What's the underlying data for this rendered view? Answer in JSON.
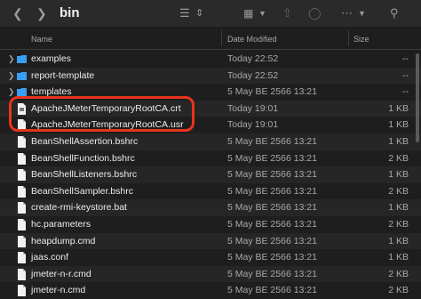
{
  "window": {
    "title": "bin"
  },
  "toolbar": {
    "back_icon": "chevron-left-icon",
    "forward_icon": "chevron-right-icon",
    "view_icon": "list-view-icon",
    "group_icon": "grid-icon",
    "share_icon": "share-icon",
    "tag_icon": "tag-icon",
    "more_icon": "ellipsis-circle-icon"
  },
  "columns": {
    "name": "Name",
    "date": "Date Modified",
    "size": "Size"
  },
  "rows": [
    {
      "name": "examples",
      "date": "Today 22:52",
      "size": "--",
      "kind": "folder"
    },
    {
      "name": "report-template",
      "date": "Today 22:52",
      "size": "--",
      "kind": "folder"
    },
    {
      "name": "templates",
      "date": "5 May BE 2566 13:21",
      "size": "--",
      "kind": "folder"
    },
    {
      "name": "ApacheJMeterTemporaryRootCA.crt",
      "date": "Today 19:01",
      "size": "1 KB",
      "kind": "cert"
    },
    {
      "name": "ApacheJMeterTemporaryRootCA.usr",
      "date": "Today 19:01",
      "size": "1 KB",
      "kind": "file"
    },
    {
      "name": "BeanShellAssertion.bshrc",
      "date": "5 May BE 2566 13:21",
      "size": "1 KB",
      "kind": "file"
    },
    {
      "name": "BeanShellFunction.bshrc",
      "date": "5 May BE 2566 13:21",
      "size": "2 KB",
      "kind": "file"
    },
    {
      "name": "BeanShellListeners.bshrc",
      "date": "5 May BE 2566 13:21",
      "size": "1 KB",
      "kind": "file"
    },
    {
      "name": "BeanShellSampler.bshrc",
      "date": "5 May BE 2566 13:21",
      "size": "2 KB",
      "kind": "file"
    },
    {
      "name": "create-rmi-keystore.bat",
      "date": "5 May BE 2566 13:21",
      "size": "1 KB",
      "kind": "file"
    },
    {
      "name": "hc.parameters",
      "date": "5 May BE 2566 13:21",
      "size": "2 KB",
      "kind": "file"
    },
    {
      "name": "heapdump.cmd",
      "date": "5 May BE 2566 13:21",
      "size": "1 KB",
      "kind": "file"
    },
    {
      "name": "jaas.conf",
      "date": "5 May BE 2566 13:21",
      "size": "1 KB",
      "kind": "file"
    },
    {
      "name": "jmeter-n-r.cmd",
      "date": "5 May BE 2566 13:21",
      "size": "2 KB",
      "kind": "file"
    },
    {
      "name": "jmeter-n.cmd",
      "date": "5 May BE 2566 13:21",
      "size": "2 KB",
      "kind": "file"
    }
  ],
  "colors": {
    "folder": "#3b9ef5",
    "highlight": "#e8341c",
    "background": "#1e1e1e"
  }
}
